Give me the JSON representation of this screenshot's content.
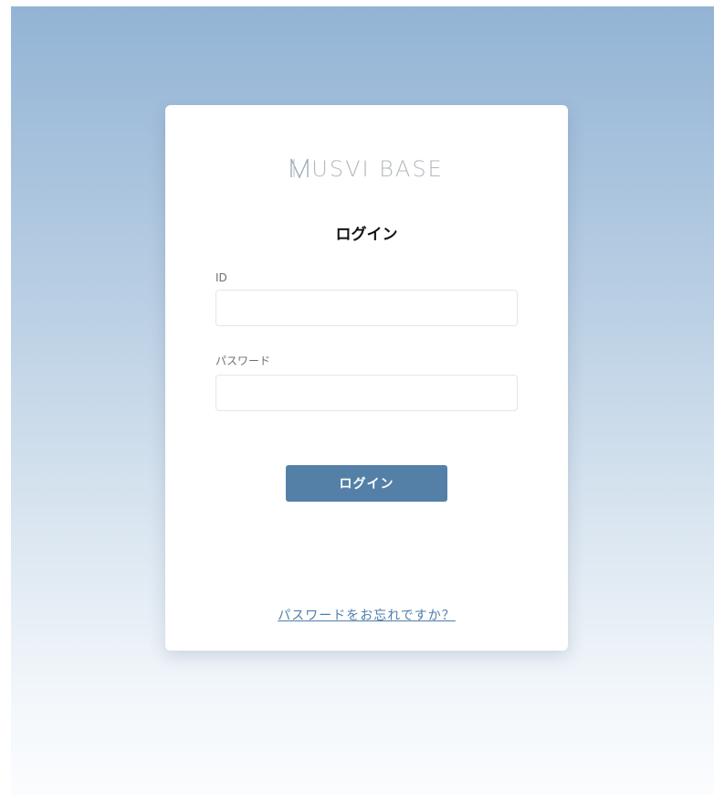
{
  "logo": {
    "text": "USVI BASE",
    "icon": "m-logo-icon"
  },
  "form": {
    "title": "ログイン",
    "id_label": "ID",
    "id_value": "",
    "password_label": "パスワード",
    "password_value": "",
    "login_button": "ログイン",
    "forgot_link": "パスワードをお忘れですか？"
  },
  "colors": {
    "bg_top": "#93b4d5",
    "bg_bottom": "#fbfcfe",
    "button": "#5480a8",
    "link": "#4f7da8"
  }
}
